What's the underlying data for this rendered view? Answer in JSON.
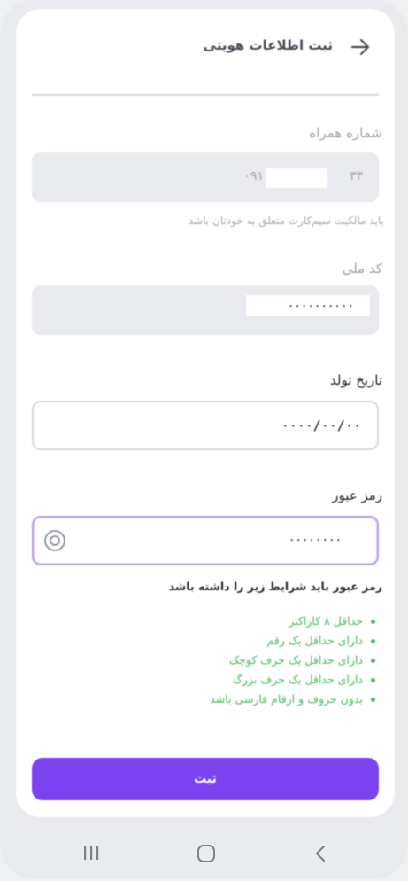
{
  "header": {
    "title": "ثبت اطلاعات هویتی"
  },
  "phone_field": {
    "label": "شماره همراه",
    "value_start": "۰۹۱",
    "value_end": "۳۳",
    "hint": "باید مالکیت سیم‌کارت متعلق به خودتان باشد"
  },
  "national_id_field": {
    "label": "کد ملی",
    "value": "۰۰۰۰۰۰۰۰۰۰"
  },
  "birth_date_field": {
    "label": "تاریخ تولد",
    "value": "۰۰۰۰/۰۰/۰۰"
  },
  "password_field": {
    "label": "رمز عبور",
    "value": "۰۰۰۰۰۰۰۰"
  },
  "password_rules": {
    "title": "رمز عبور باید شرایط زیر را داشته باشد",
    "items": [
      "حداقل ۸ کاراکتر",
      "دارای حداقل یک رقم",
      "دارای حداقل یک حرف کوچک",
      "دارای حداقل یک حرف بزرگ",
      "بدون حروف و ارقام فارسی باشد"
    ]
  },
  "submit": {
    "label": "ثبت"
  },
  "colors": {
    "accent": "#7a43ef",
    "success": "#4cbb63",
    "focus_border": "#b79ced"
  },
  "icons": {
    "back": "arrow-right-icon",
    "eye": "eye-icon",
    "nav_recents": "recents-icon",
    "nav_home": "home-icon",
    "nav_back": "chevron-left-icon"
  }
}
